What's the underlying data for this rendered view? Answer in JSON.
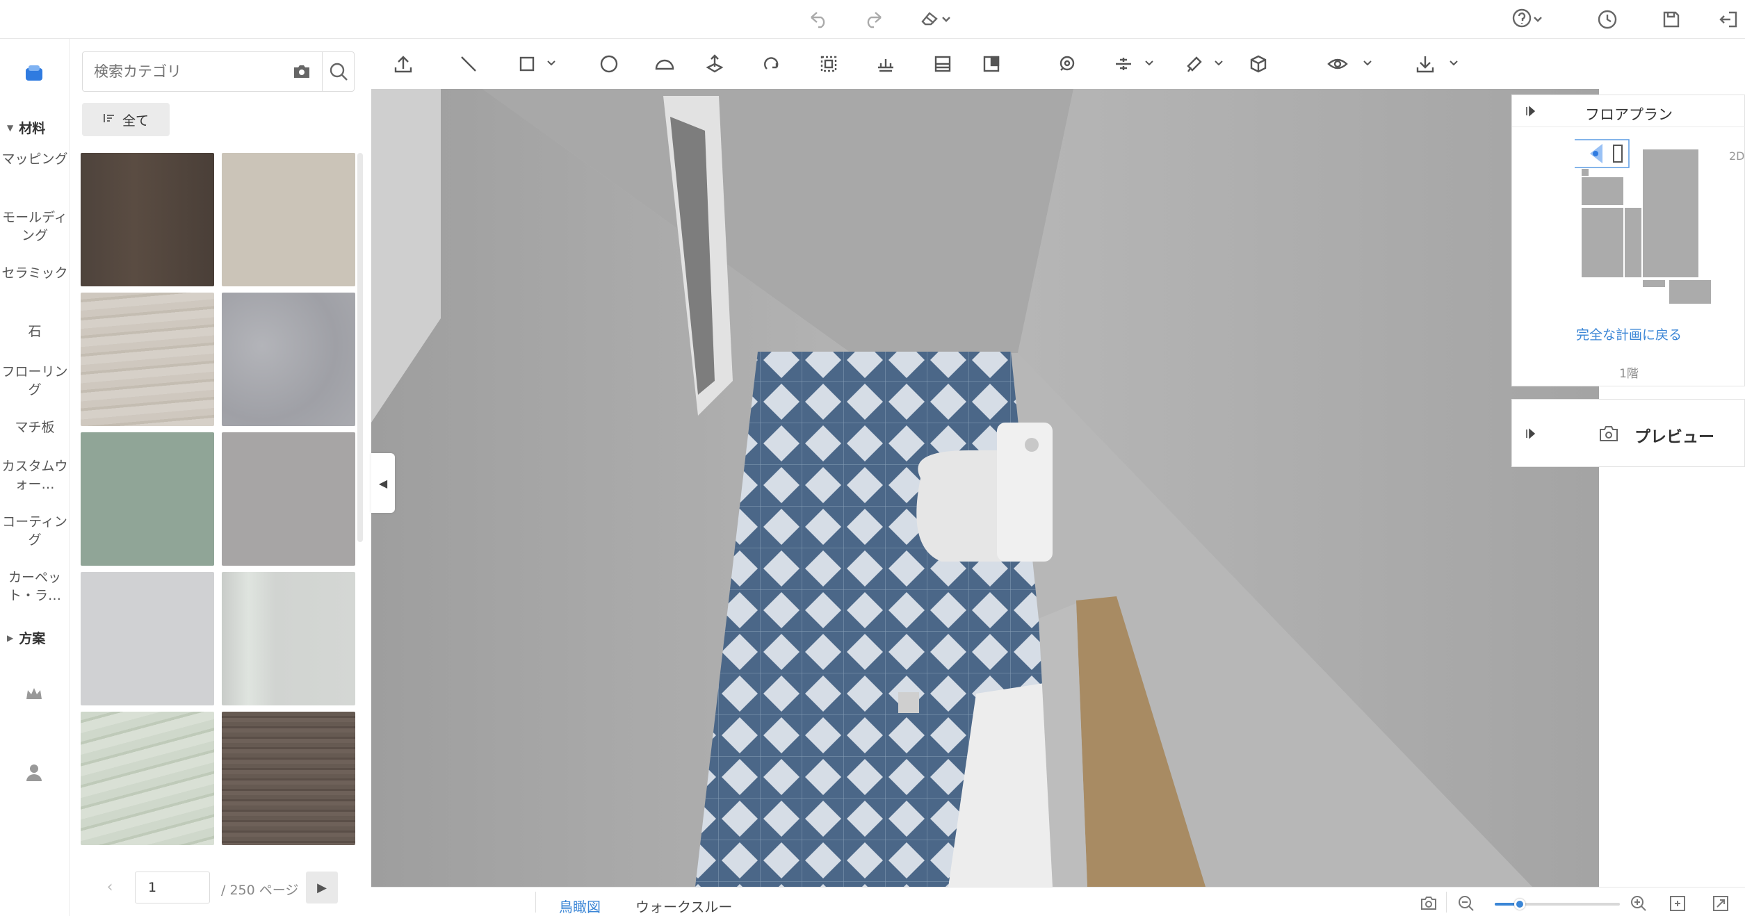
{
  "topbar": {
    "undo_icon": "undo-icon",
    "redo_icon": "redo-icon",
    "eraser_icon": "eraser-icon",
    "help_icon": "help-icon",
    "history_icon": "history-icon",
    "save_icon": "save-icon",
    "exit_icon": "exit-icon"
  },
  "rail": {
    "section_materials": "材料",
    "categories": [
      "マッピング",
      "モールディング",
      "セラミック",
      "石",
      "フローリング",
      "マチ板",
      "カスタムウォー…",
      "コーティング",
      "カーペット・ラ…"
    ],
    "section_plans": "方案"
  },
  "panel": {
    "search_placeholder": "検索カテゴリ",
    "filter_label": "全て",
    "swatches": [
      "#4e433c",
      "#cbc4b8",
      "#cfc8bf",
      "#a7a8ad",
      "#90a597",
      "#a7a5a5",
      "#d0d1d3",
      "#d4d7d4",
      "#cfd8cb",
      "#665a52"
    ],
    "page_value": "1",
    "page_total": "/ 250 ページ"
  },
  "right": {
    "floorplan_title": "フロアプラン",
    "tag_2d": "2D",
    "back_link": "完全な計画に戻る",
    "floor_label": "1階",
    "preview_title": "プレビュー"
  },
  "bottom": {
    "mode_birdseye": "鳥瞰図",
    "mode_walkthrough": "ウォークスルー",
    "zoom_level": 0.2
  },
  "colors": {
    "accent": "#3b86d6",
    "tile_dark": "#4b6788",
    "tile_light": "#d6dde6",
    "wall": "#a9a9a9",
    "wood": "#a88b63"
  }
}
